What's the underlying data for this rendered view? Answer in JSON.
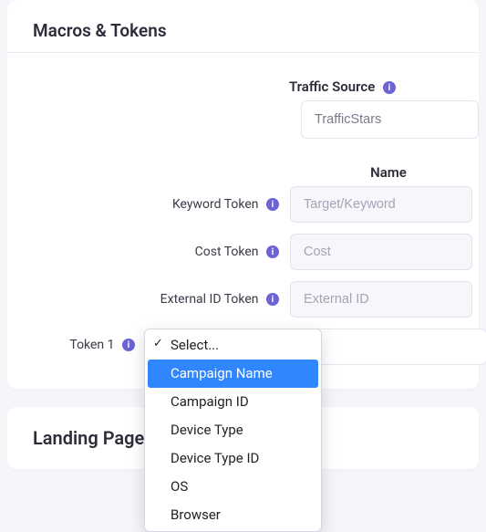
{
  "sections": {
    "macros_title": "Macros & Tokens",
    "landing_title": "Landing Pages"
  },
  "traffic": {
    "label": "Traffic Source",
    "value": "TrafficStars"
  },
  "columns": {
    "name": "Name"
  },
  "tokens": {
    "keyword": {
      "label": "Keyword Token",
      "placeholder": "Target/Keyword"
    },
    "cost": {
      "label": "Cost Token",
      "placeholder": "Cost"
    },
    "external": {
      "label": "External ID Token",
      "placeholder": "External ID"
    },
    "token1": {
      "label": "Token 1"
    }
  },
  "dropdown": {
    "placeholder": "Select...",
    "options": [
      "Campaign Name",
      "Campaign ID",
      "Device Type",
      "Device Type ID",
      "OS",
      "Browser"
    ],
    "highlighted": "Campaign Name"
  }
}
